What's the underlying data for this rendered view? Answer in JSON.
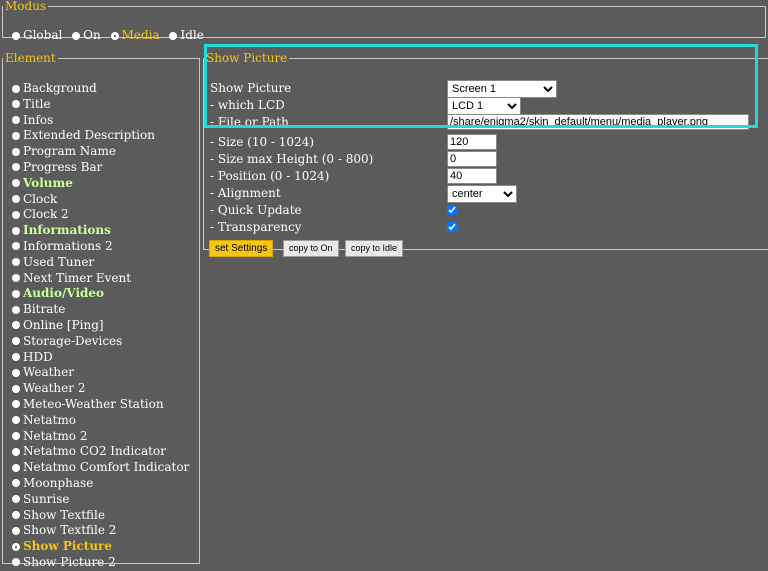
{
  "modus": {
    "legend": "Modus",
    "options": [
      {
        "label": "Global",
        "checked": false
      },
      {
        "label": "On",
        "checked": false
      },
      {
        "label": "Media",
        "checked": true
      },
      {
        "label": "Idle",
        "checked": false
      }
    ]
  },
  "element": {
    "legend": "Element",
    "items": [
      {
        "label": "Background"
      },
      {
        "label": "Title"
      },
      {
        "label": "Infos"
      },
      {
        "label": "Extended Description"
      },
      {
        "label": "Program Name"
      },
      {
        "label": "Progress Bar"
      },
      {
        "label": "Volume",
        "bold": true
      },
      {
        "label": "Clock"
      },
      {
        "label": "Clock 2"
      },
      {
        "label": "Informations",
        "bold": true
      },
      {
        "label": "Informations 2"
      },
      {
        "label": "Used Tuner"
      },
      {
        "label": "Next Timer Event"
      },
      {
        "label": "Audio/Video",
        "bold": true
      },
      {
        "label": "Bitrate"
      },
      {
        "label": "Online [Ping]"
      },
      {
        "label": "Storage-Devices"
      },
      {
        "label": "HDD"
      },
      {
        "label": "Weather"
      },
      {
        "label": "Weather 2"
      },
      {
        "label": "Meteo-Weather Station"
      },
      {
        "label": "Netatmo"
      },
      {
        "label": "Netatmo 2"
      },
      {
        "label": "Netatmo CO2 Indicator"
      },
      {
        "label": "Netatmo Comfort Indicator"
      },
      {
        "label": "Moonphase"
      },
      {
        "label": "Sunrise"
      },
      {
        "label": "Show Textfile"
      },
      {
        "label": "Show Textfile 2"
      },
      {
        "label": "Show Picture",
        "active": true
      },
      {
        "label": "Show Picture 2"
      }
    ]
  },
  "show_picture": {
    "legend": "Show Picture",
    "show_picture_label": "Show Picture",
    "show_picture_value": "Screen 1",
    "which_lcd_label": "- which LCD",
    "which_lcd_value": "LCD 1",
    "file_label": "- File or Path",
    "file_value": "/share/enigma2/skin_default/menu/media_player.png",
    "size_label": "- Size (10 - 1024)",
    "size_value": "120",
    "max_height_label": "- Size max Height (0 - 800)",
    "max_height_value": "0",
    "position_label": "- Position (0 - 1024)",
    "position_value": "40",
    "alignment_label": "- Alignment",
    "alignment_value": "center",
    "quick_update_label": "- Quick Update",
    "quick_update_checked": true,
    "transparency_label": "- Transparency",
    "transparency_checked": true,
    "set_settings_label": "set Settings",
    "copy_on_label": "copy to On",
    "copy_idle_label": "copy to Idle"
  },
  "colors": {
    "background": "#5b5b5b",
    "legend": "#f5c518",
    "highlight": "#24d8d8",
    "bold_item": "#ccff99"
  }
}
